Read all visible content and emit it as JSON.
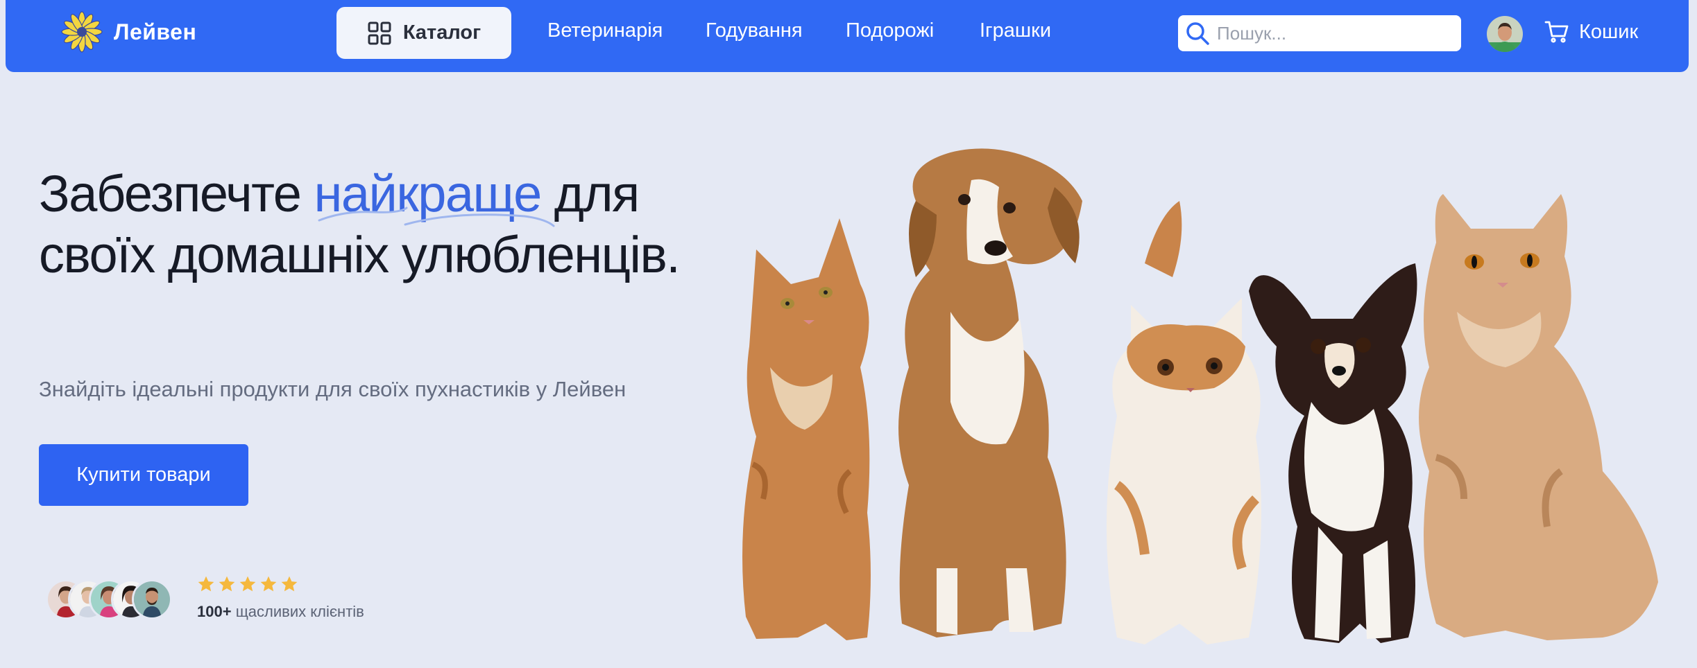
{
  "brand": {
    "name": "Лейвен",
    "accent": "#3069f4",
    "logo_icon": "sunflower-icon"
  },
  "nav": {
    "catalog_label": "Каталог",
    "catalog_icon": "grid-icon",
    "links": [
      "Ветеринарія",
      "Годування",
      "Подорожі",
      "Іграшки"
    ]
  },
  "search": {
    "placeholder": "Пошук...",
    "value": "",
    "icon": "search-icon"
  },
  "cart": {
    "label": "Кошик",
    "icon": "cart-icon"
  },
  "hero": {
    "title_before": "Забезпечте ",
    "title_accent": "найкраще",
    "title_after": " для своїх домашніх улюбленців.",
    "subtitle": "Знайдіть ідеальні продукти для своїх пухнастиків у Лейвен",
    "cta_label": "Купити товари"
  },
  "social_proof": {
    "stars": 5,
    "count": "100+",
    "label": "щасливих клієнтів"
  }
}
